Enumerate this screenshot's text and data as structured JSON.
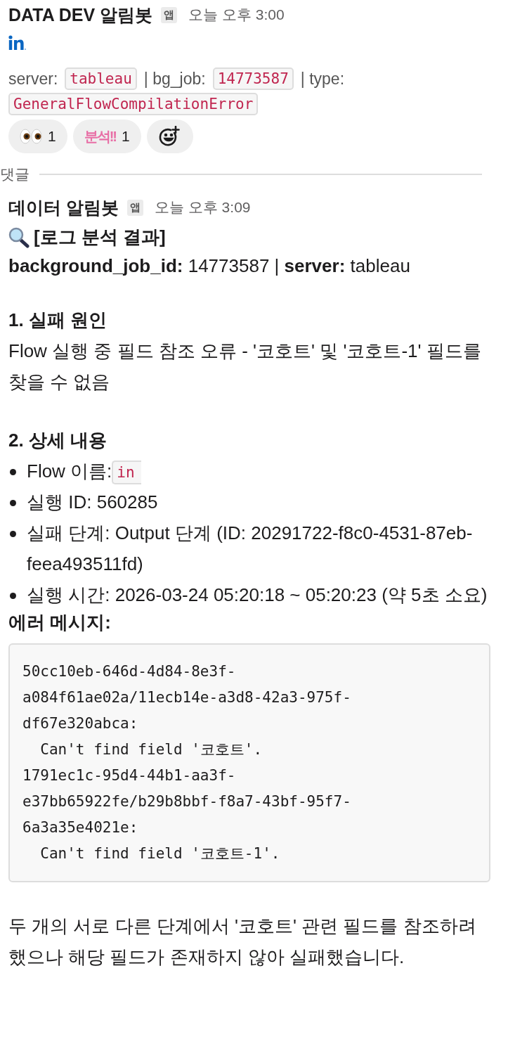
{
  "message": {
    "sender": "DATA DEV 알림봇",
    "badge": "앱",
    "time": "오늘 오후 3:00",
    "meta": [
      {
        "kind": "label",
        "text": "server:"
      },
      {
        "kind": "code",
        "text": "tableau"
      },
      {
        "kind": "label",
        "text": "|  bg_job:"
      },
      {
        "kind": "code",
        "text": "14773587"
      },
      {
        "kind": "label",
        "text": "|  type:"
      },
      {
        "kind": "code",
        "text": "GeneralFlowCompilationError"
      }
    ],
    "reactions": [
      {
        "kind": "eyes",
        "count": "1"
      },
      {
        "kind": "text_emoji",
        "emoji": "분석!!",
        "count": "1"
      },
      {
        "kind": "add"
      }
    ]
  },
  "divider_label": "댓글",
  "reply": {
    "sender": "데이터 알림봇",
    "badge": "앱",
    "time": "오늘 오후 3:09",
    "title": "[로그 분석 결과]",
    "summary": "**background_job_id:** 14773587  |  **server:** tableau",
    "sections": [
      {
        "heading": "1. 실패 원인",
        "body": "Flow 실행 중 필드 참조 오류 - '코호트' 및 '코호트-1' 필드를 찾을 수 없음"
      },
      {
        "heading": "2. 상세 내용",
        "bullets": [
          {
            "label": "Flow 이름:",
            "code": "in"
          },
          {
            "text": "실행 ID: 560285"
          },
          {
            "text": "실패 단계: Output 단계 (ID: 20291722-f8c0-4531-87eb-feea493511fd)"
          },
          {
            "text": "실행 시간: 2026-03-24 05:20:18 ~ 05:20:23 (약 5초 소요)"
          }
        ]
      }
    ],
    "error_heading": "에러 메시지:",
    "error_code": "50cc10eb-646d-4d84-8e3f-\na084f61ae02a/11ecb14e-a3d8-42a3-975f-\ndf67e320abca:\n  Can't find field '코호트'.\n1791ec1c-95d4-44b1-aa3f-\ne37bb65922fe/b29b8bbf-f8a7-43bf-95f7-\n6a3a35e4021e:\n  Can't find field '코호트-1'.",
    "conclusion": "두 개의 서로 다른 단계에서 '코호트' 관련 필드를 참조하려 했으나 해당 필드가 존재하지 않아 실패했습니다."
  }
}
